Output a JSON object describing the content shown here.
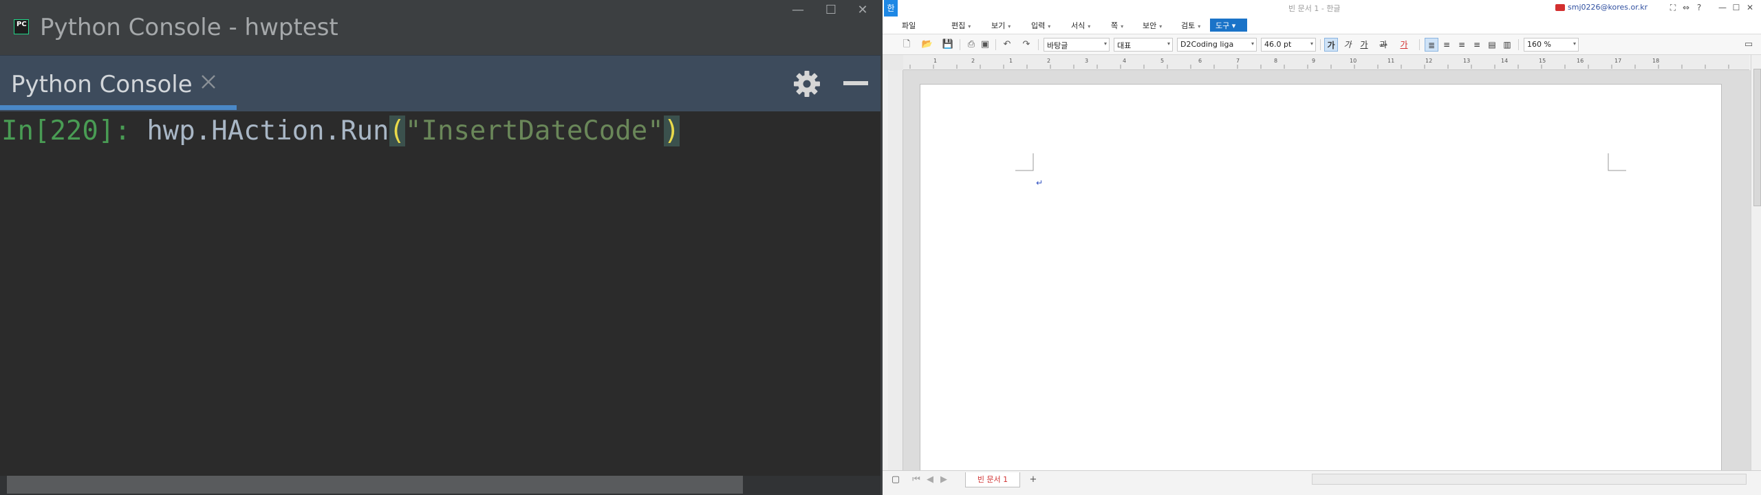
{
  "console": {
    "window_title": "Python Console - hwptest",
    "tab_label": "Python Console",
    "prompt": "In[220]:",
    "code_prefix": " hwp.HAction.Run",
    "paren_open": "(",
    "string_literal": "\"InsertDateCode\"",
    "paren_close": ")",
    "win_min": "—",
    "win_max": "☐",
    "win_close": "✕",
    "colors": {
      "background": "#2b2b2b",
      "prompt": "#499c54",
      "string": "#6a8759",
      "paren": "#e8d94a",
      "tab_accent": "#4a88c7"
    }
  },
  "hwp": {
    "logo": "한",
    "doc_title": "빈 문서 1 - 한글",
    "user": "smj0226@kores.or.kr",
    "help_icon": "?",
    "menu": {
      "file": "파일",
      "edit": "편집",
      "view": "보기",
      "input": "입력",
      "format": "서식",
      "page": "쪽",
      "security": "보안",
      "review": "검토",
      "tools": "도구"
    },
    "toolbar": {
      "style": "바탕글",
      "lang": "대표",
      "font": "D2Coding liga",
      "size": "46.0",
      "size_unit": "pt",
      "bold": "가",
      "italic": "가",
      "underline": "가",
      "strike": "과",
      "color": "가",
      "zoom": "160",
      "zoom_unit": "%"
    },
    "ruler_numbers": [
      "1",
      "2",
      "1",
      "2",
      "3",
      "4",
      "5",
      "6",
      "7",
      "8",
      "9",
      "10",
      "11",
      "12",
      "13",
      "14",
      "15",
      "16",
      "17",
      "18"
    ],
    "doc_tab": "빈 문서 1",
    "new_tab_button": "+",
    "return_mark": "↵"
  }
}
